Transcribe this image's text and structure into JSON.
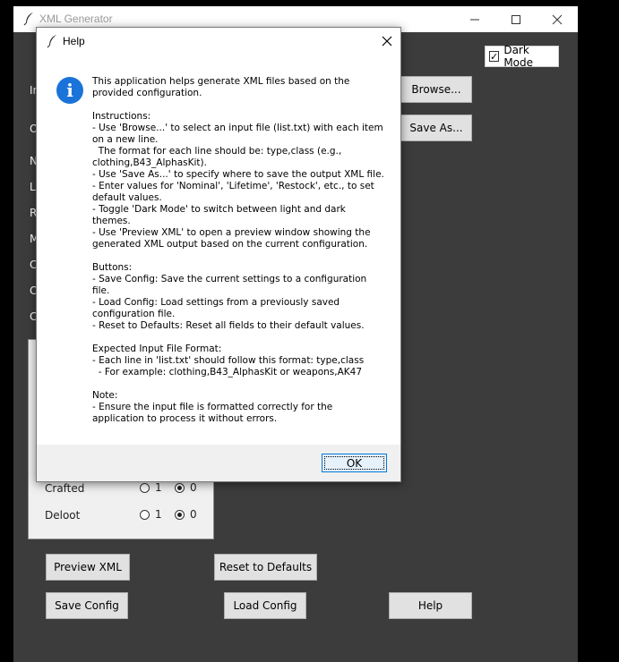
{
  "main_window": {
    "title": "XML Generator",
    "controls": {
      "minimize": "–",
      "maximize": "☐",
      "close": "✕"
    }
  },
  "dark_mode": {
    "label": "Dark Mode",
    "checked": true
  },
  "buttons": {
    "browse": "Browse...",
    "save_as": "Save As...",
    "preview_xml": "Preview XML",
    "reset_defaults": "Reset to Defaults",
    "save_config": "Save Config",
    "load_config": "Load Config",
    "help": "Help"
  },
  "side_labels": [
    "In",
    "O",
    "N",
    "Li",
    "R",
    "M",
    "C",
    "C",
    "C"
  ],
  "flags": [
    {
      "label": "Crafted",
      "options": [
        "1",
        "0"
      ],
      "selected": "0"
    },
    {
      "label": "Deloot",
      "options": [
        "1",
        "0"
      ],
      "selected": "0"
    }
  ],
  "help_dialog": {
    "title": "Help",
    "icon": "info-icon",
    "ok_label": "OK",
    "body": "This application helps generate XML files based on the\nprovided configuration.\n\nInstructions:\n- Use 'Browse...' to select an input file (list.txt) with each item\non a new line.\n  The format for each line should be: type,class (e.g.,\nclothing,B43_AlphasKit).\n- Use 'Save As...' to specify where to save the output XML file.\n- Enter values for 'Nominal', 'Lifetime', 'Restock', etc., to set\ndefault values.\n- Toggle 'Dark Mode' to switch between light and dark\nthemes.\n- Use 'Preview XML' to open a preview window showing the\ngenerated XML output based on the current configuration.\n\nButtons:\n- Save Config: Save the current settings to a configuration\nfile.\n- Load Config: Load settings from a previously saved\nconfiguration file.\n- Reset to Defaults: Reset all fields to their default values.\n\nExpected Input File Format:\n- Each line in 'list.txt' should follow this format: type,class\n  - For example: clothing,B43_AlphasKit or weapons,AK47\n\nNote:\n- Ensure the input file is formatted correctly for the\napplication to process it without errors."
  }
}
